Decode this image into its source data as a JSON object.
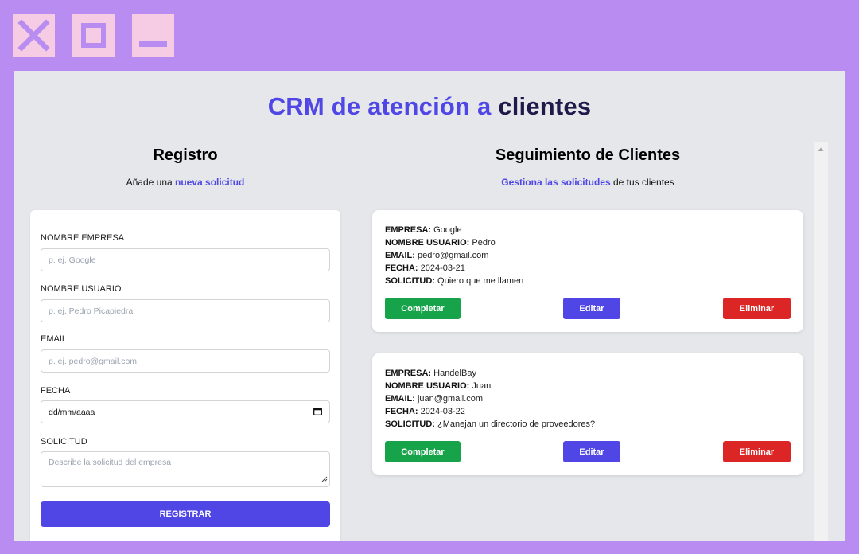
{
  "window_controls": {
    "close_icon": "close-icon",
    "maximize_icon": "maximize-icon",
    "minimize_icon": "minimize-icon"
  },
  "colors": {
    "background": "#b98cf2",
    "accent": "#4f46e5",
    "complete": "#16a34a",
    "delete": "#dc2626"
  },
  "header": {
    "title_part1": "CRM de atención a",
    "title_part2": "clientes"
  },
  "registro": {
    "title": "Registro",
    "subtitle_prefix": "Añade una",
    "subtitle_accent": "nueva solicitud",
    "fields": {
      "empresa_label": "NOMBRE EMPRESA",
      "empresa_placeholder": "p. ej. Google",
      "usuario_label": "NOMBRE USUARIO",
      "usuario_placeholder": "p. ej. Pedro Picapiedra",
      "email_label": "EMAIL",
      "email_placeholder": "p. ej. pedro@gmail.com",
      "fecha_label": "FECHA",
      "fecha_placeholder": "dd/mm/aaaa",
      "solicitud_label": "SOLICITUD",
      "solicitud_placeholder": "Describe la solicitud del empresa"
    },
    "submit_label": "REGISTRAR"
  },
  "seguimiento": {
    "title": "Seguimiento de Clientes",
    "subtitle_accent": "Gestiona las solicitudes",
    "subtitle_suffix": "de tus clientes",
    "labels": {
      "empresa": "EMPRESA:",
      "usuario": "NOMBRE USUARIO:",
      "email": "EMAIL:",
      "fecha": "FECHA:",
      "solicitud": "SOLICITUD:"
    },
    "clients": [
      {
        "empresa": "Google",
        "usuario": "Pedro",
        "email": "pedro@gmail.com",
        "fecha": "2024-03-21",
        "solicitud": "Quiero que me llamen"
      },
      {
        "empresa": "HandelBay",
        "usuario": "Juan",
        "email": "juan@gmail.com",
        "fecha": "2024-03-22",
        "solicitud": "¿Manejan un directorio de proveedores?"
      }
    ],
    "buttons": {
      "complete": "Completar",
      "edit": "Editar",
      "delete": "Eliminar"
    }
  }
}
